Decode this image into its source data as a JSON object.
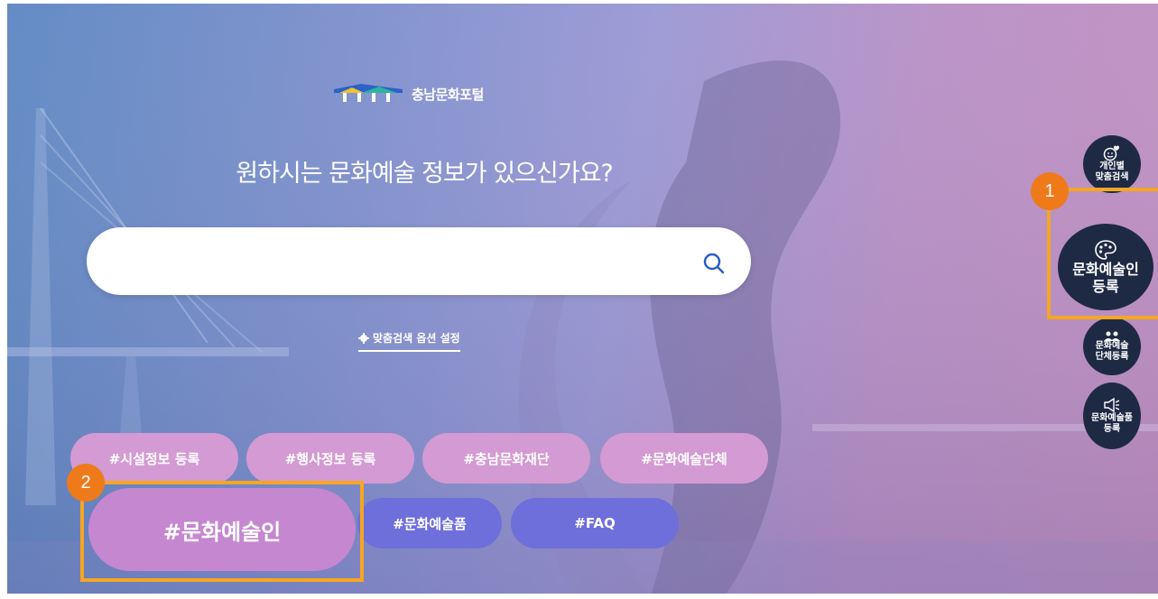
{
  "logo": {
    "text": "충남문화포털"
  },
  "headline": "원하시는 문화예술 정보가 있으신가요?",
  "search": {
    "placeholder": "",
    "value": ""
  },
  "search_options_label": "맞춤검색 옵션 설정",
  "tags": {
    "row1": [
      "#시설정보 등록",
      "#행사정보 등록",
      "#충남문화재단",
      "#문화예술단체"
    ],
    "row2": [
      "#문화예술인",
      "#문화예술품",
      "#FAQ"
    ]
  },
  "side_menu": {
    "personal": "개인별\n맞춤검색",
    "artist": "문화예술인\n등록",
    "group": "문화예술\n단체등록",
    "artwork": "문화예술품\n등록"
  },
  "callouts": [
    "1",
    "2"
  ],
  "colors": {
    "highlight": "#f5a623",
    "badge": "#ee7a1a",
    "side_button": "#1e2a44",
    "tag_pink": "#d49ad3",
    "tag_blue": "#6e6fdb"
  }
}
